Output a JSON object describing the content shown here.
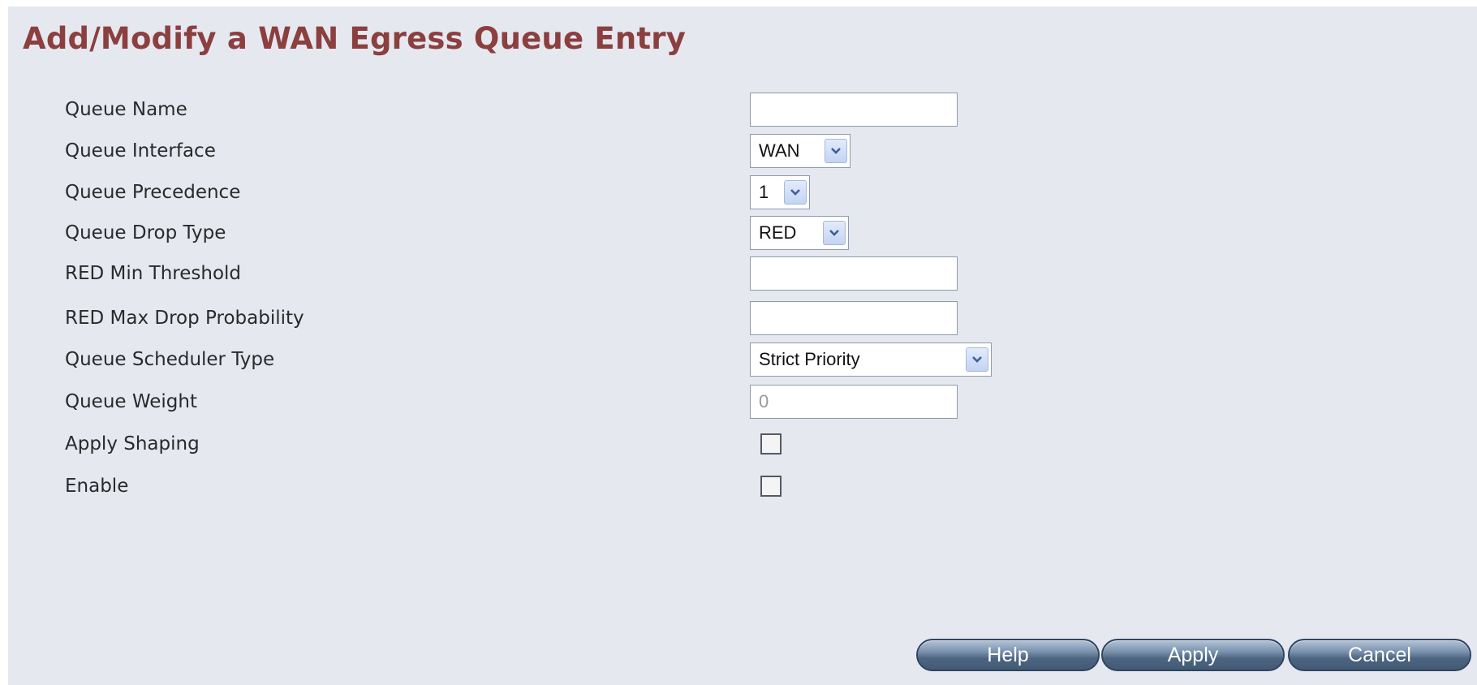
{
  "page": {
    "title": "Add/Modify a WAN Egress Queue Entry"
  },
  "form": {
    "queue_name": {
      "label": "Queue Name",
      "value": ""
    },
    "queue_interface": {
      "label": "Queue Interface",
      "selected": "WAN"
    },
    "queue_precedence": {
      "label": "Queue Precedence",
      "selected": "1"
    },
    "queue_drop_type": {
      "label": "Queue Drop Type",
      "selected": "RED"
    },
    "red_min_threshold": {
      "label": "RED Min Threshold",
      "value": ""
    },
    "red_max_drop_probability": {
      "label": "RED Max Drop Probability",
      "value": ""
    },
    "queue_scheduler_type": {
      "label": "Queue Scheduler Type",
      "selected": "Strict Priority"
    },
    "queue_weight": {
      "label": "Queue Weight",
      "value": "0",
      "disabled": true
    },
    "apply_shaping": {
      "label": "Apply Shaping",
      "checked": false
    },
    "enable": {
      "label": "Enable",
      "checked": false
    }
  },
  "buttons": {
    "help": "Help",
    "apply": "Apply",
    "cancel": "Cancel"
  },
  "colors": {
    "title": "#8b3f3f",
    "background": "#e6e8f0",
    "button": "#4d6581"
  },
  "icons": {
    "dropdown": "chevron-down-icon"
  }
}
